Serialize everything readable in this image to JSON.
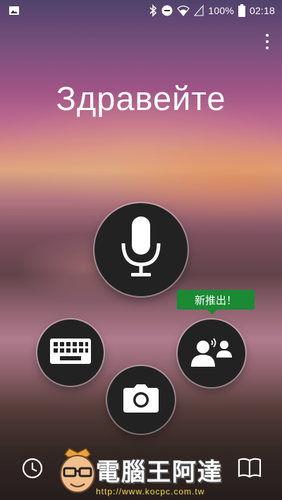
{
  "status_bar": {
    "battery_percent": "100%",
    "time": "02:18",
    "icons": [
      "image-icon",
      "bluetooth-icon",
      "do-not-disturb-icon",
      "wifi-icon",
      "cell-signal-icon",
      "battery-icon"
    ]
  },
  "menu": {
    "icon": "more-vert-icon"
  },
  "greeting": "Здравейте",
  "actions": {
    "voice": {
      "icon": "microphone-icon"
    },
    "keyboard": {
      "icon": "keyboard-icon"
    },
    "camera": {
      "icon": "camera-icon"
    },
    "conversation": {
      "icon": "conversation-icon",
      "badge": "新推出！"
    }
  },
  "bottom_bar": {
    "history": {
      "icon": "history-icon"
    },
    "phrasebook": {
      "icon": "book-icon"
    }
  },
  "watermark": {
    "title": "電腦王阿達",
    "url": "http://www.kocpc.com.tw"
  },
  "colors": {
    "badge": "#1a8a33",
    "circle": "#222222"
  }
}
